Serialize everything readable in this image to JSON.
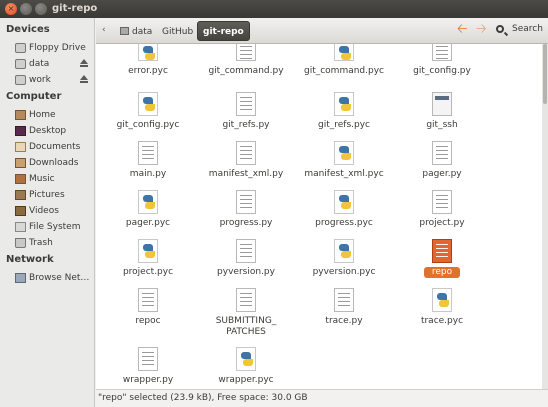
{
  "window": {
    "title": "git-repo",
    "close_glyph": "×"
  },
  "sidebar": {
    "devices_heading": "Devices",
    "computer_heading": "Computer",
    "network_heading": "Network",
    "devices": [
      {
        "label": "Floppy Drive",
        "icon": "floppy-icon",
        "eject": false
      },
      {
        "label": "data",
        "icon": "drive-icon",
        "eject": true
      },
      {
        "label": "work",
        "icon": "drive-icon",
        "eject": true
      }
    ],
    "computer": [
      {
        "label": "Home",
        "icon": "home-folder-icon"
      },
      {
        "label": "Desktop",
        "icon": "desktop-icon"
      },
      {
        "label": "Documents",
        "icon": "documents-folder-icon"
      },
      {
        "label": "Downloads",
        "icon": "downloads-folder-icon"
      },
      {
        "label": "Music",
        "icon": "music-folder-icon"
      },
      {
        "label": "Pictures",
        "icon": "pictures-folder-icon"
      },
      {
        "label": "Videos",
        "icon": "videos-folder-icon"
      },
      {
        "label": "File System",
        "icon": "filesystem-icon"
      },
      {
        "label": "Trash",
        "icon": "trash-icon"
      }
    ],
    "network": [
      {
        "label": "Browse Net…",
        "icon": "network-icon"
      }
    ]
  },
  "toolbar": {
    "back_glyph": "‹",
    "breadcrumbs": [
      {
        "label": "data",
        "active": false
      },
      {
        "label": "GitHub",
        "active": false
      },
      {
        "label": "git-repo",
        "active": true
      }
    ],
    "prev_glyph": "🡠",
    "next_glyph": "🡢",
    "search_label": "Search"
  },
  "files": [
    {
      "name": "error.pyc",
      "type": "pyc"
    },
    {
      "name": "git_command.py",
      "type": "py"
    },
    {
      "name": "git_command.pyc",
      "type": "pyc"
    },
    {
      "name": "git_config.py",
      "type": "py"
    },
    {
      "name": "git_config.pyc",
      "type": "pyc"
    },
    {
      "name": "git_refs.py",
      "type": "py"
    },
    {
      "name": "git_refs.pyc",
      "type": "pyc"
    },
    {
      "name": "git_ssh",
      "type": "shell"
    },
    {
      "name": "main.py",
      "type": "py"
    },
    {
      "name": "manifest_xml.py",
      "type": "py"
    },
    {
      "name": "manifest_xml.pyc",
      "type": "pyc"
    },
    {
      "name": "pager.py",
      "type": "py"
    },
    {
      "name": "pager.pyc",
      "type": "pyc"
    },
    {
      "name": "progress.py",
      "type": "py"
    },
    {
      "name": "progress.pyc",
      "type": "pyc"
    },
    {
      "name": "project.py",
      "type": "py"
    },
    {
      "name": "project.pyc",
      "type": "pyc"
    },
    {
      "name": "pyversion.py",
      "type": "py"
    },
    {
      "name": "pyversion.pyc",
      "type": "pyc"
    },
    {
      "name": "repo",
      "type": "py",
      "selected": true
    },
    {
      "name": "repoc",
      "type": "py"
    },
    {
      "name": "SUBMITTING_",
      "name2": "PATCHES",
      "type": "text"
    },
    {
      "name": "trace.py",
      "type": "py"
    },
    {
      "name": "trace.pyc",
      "type": "pyc"
    },
    {
      "name": "wrapper.py",
      "type": "py"
    },
    {
      "name": "wrapper.pyc",
      "type": "pyc"
    }
  ],
  "status": {
    "text": "\"repo\" selected (23.9 kB), Free space: 30.0 GB"
  }
}
